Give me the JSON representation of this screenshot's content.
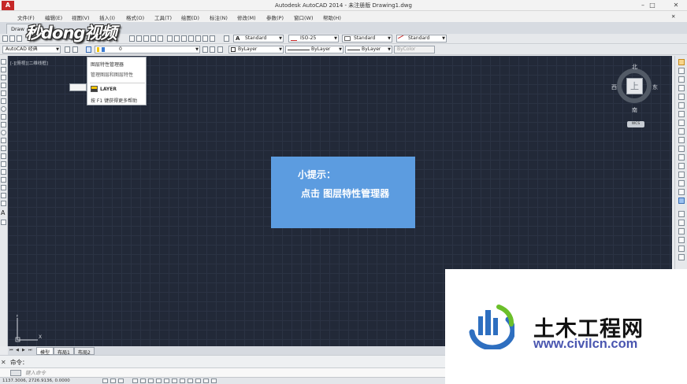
{
  "window": {
    "app_logo": "A",
    "title": "Autodesk AutoCAD 2014 - 未注册版    Drawing1.dwg",
    "minimize": "–",
    "maximize": "□",
    "close": "✕"
  },
  "menubar": {
    "items": [
      "文件(F)",
      "编辑(E)",
      "视图(V)",
      "插入(I)",
      "格式(O)",
      "工具(T)",
      "绘图(D)",
      "标注(N)",
      "修改(M)",
      "参数(P)",
      "窗口(W)",
      "帮助(H)"
    ],
    "close_doc": "✕"
  },
  "doc_tab": {
    "label": "Draw"
  },
  "watermark_logo": "秒dong视频",
  "toolbar_styles": {
    "text_style": "Standard",
    "dim_style": "ISO-25",
    "table_style": "Standard",
    "multileader_style": "Standard"
  },
  "toolbar_layers": {
    "workspace": "AutoCAD 经典",
    "current_layer": "0",
    "color": "ByLayer",
    "linetype": "ByLayer",
    "lineweight": "ByLayer",
    "plotstyle": "ByColor"
  },
  "viewport_label": "[-][俯视][二维线框]",
  "tooltip": {
    "line1": "图层特性管理器",
    "line2": "管理图层和图层特性",
    "command": "LAYER",
    "help": "按 F1 键获得更多帮助"
  },
  "viewcube": {
    "north": "北",
    "south": "南",
    "east": "东",
    "west": "西",
    "face": "上",
    "wcs": "WCS"
  },
  "hint": {
    "title": "小提示：",
    "body": "点击  图层特性管理器"
  },
  "ucs": {
    "x": "X",
    "y": "Y"
  },
  "layout_tabs": {
    "nav": [
      "⏮",
      "◀",
      "▶",
      "⏭"
    ],
    "tabs": [
      "模型",
      "布局1",
      "布局2"
    ]
  },
  "command": {
    "history_label": "命令：",
    "placeholder": "键入命令",
    "close": "✕"
  },
  "status": {
    "coords": "1137.3006, 2726.9136, 0.0000"
  },
  "brand": {
    "name": "土木工程网",
    "url": "www.civilcn.com",
    "colors": {
      "blue": "#2e6fc0",
      "green": "#6bbf2a",
      "dark": "#121212"
    }
  },
  "colors": {
    "canvas_bg": "#222938",
    "hint_bg": "#5c9ce0",
    "accent_red": "#c62828"
  }
}
